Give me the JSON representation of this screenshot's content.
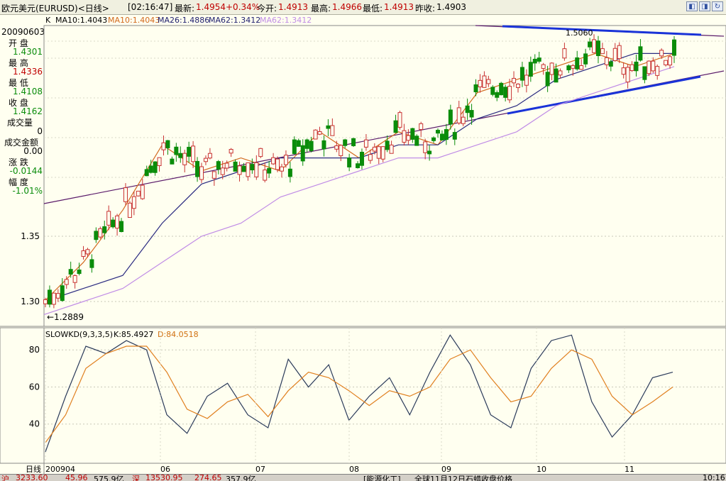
{
  "header": {
    "instrument": "欧元美元(EURUSD)<日线>",
    "time": "[02:16:47]",
    "latest_label": "最新:",
    "latest": "1.4954",
    "change": "+0.34%",
    "open_label": "今开:",
    "open": "1.4913",
    "high_label": "最高:",
    "high": "1.4966",
    "low_label": "最低:",
    "low": "1.4913",
    "prev_label": "昨收:",
    "prev": "1.4903"
  },
  "ma_legend": {
    "prefix": "K",
    "ma10a": "MA10:1.4043",
    "ma10b": "MA10:1.4043",
    "ma26": "MA26:1.4886",
    "ma62": "MA62:1.3412",
    "ma62b": "MA62:1.3412"
  },
  "info_panel": {
    "date": "20090603",
    "open_label": "开  盘",
    "open": "1.4301",
    "high_label": "最  高",
    "high": "1.4336",
    "low_label": "最  低",
    "low": "1.4108",
    "close_label": "收  盘",
    "close": "1.4162",
    "volume_label": "成交量",
    "volume": "0",
    "amount_label": "成交金额",
    "amount": "0.00",
    "change_label": "涨  跌",
    "change": "-0.0144",
    "range_label": "幅  度",
    "range": "-1.01%"
  },
  "price_axis": {
    "ticks": [
      "1.35",
      "1.30"
    ]
  },
  "annotations": {
    "max": "1.5060",
    "min": "←1.2889"
  },
  "kd_legend": {
    "name": "SLOWKD(9,3,3,5)",
    "k": "K:85.4927",
    "d": "D:84.0518"
  },
  "kd_axis": {
    "ticks": [
      "80",
      "60",
      "40"
    ]
  },
  "time_axis": {
    "label": "日线",
    "ticks": [
      "200904",
      "06",
      "07",
      "08",
      "09",
      "10",
      "11"
    ]
  },
  "status_bar": {
    "a": "沪",
    "b": "3233.60",
    "c": "45.96",
    "d": "575.9亿",
    "e": "深",
    "f": "13530.95",
    "g": "274.65",
    "h": "357.9亿",
    "i": "[能源化工]",
    "j": "全球11月12日石蜡收盘价格",
    "k": "10:16"
  },
  "colors": {
    "up": "#c83232",
    "down": "#0a8c0a",
    "ma10": "#d2691e",
    "ma26": "#2a2a80",
    "ma62": "#c08ce6",
    "k_line": "#2a3a5a",
    "d_line": "#e08020",
    "trend": "#1a33d8",
    "trend_thin": "#5a1a6a"
  },
  "chart_data": [
    {
      "type": "candlestick",
      "title": "欧元美元(EURUSD)<日线>",
      "x": [
        "200904",
        "06",
        "07",
        "08",
        "09",
        "10",
        "11"
      ],
      "ylim": [
        1.2889,
        1.506
      ],
      "ticks": [
        1.3,
        1.35
      ],
      "series": [
        {
          "name": "MA10",
          "values": [
            1.3,
            1.33,
            1.37,
            1.42,
            1.4,
            1.41,
            1.4,
            1.43,
            1.41,
            1.43,
            1.42,
            1.46,
            1.47,
            1.48,
            1.49,
            1.48,
            1.49
          ]
        },
        {
          "name": "MA26",
          "values": [
            1.3,
            1.31,
            1.32,
            1.36,
            1.39,
            1.4,
            1.41,
            1.41,
            1.41,
            1.42,
            1.42,
            1.44,
            1.45,
            1.47,
            1.48,
            1.49,
            1.49
          ]
        },
        {
          "name": "MA62",
          "values": [
            1.29,
            1.3,
            1.31,
            1.33,
            1.35,
            1.36,
            1.38,
            1.39,
            1.4,
            1.41,
            1.41,
            1.42,
            1.43,
            1.45,
            1.46,
            1.47,
            1.48
          ]
        }
      ],
      "annotations": [
        "1.5060",
        "←1.2889"
      ]
    },
    {
      "type": "line",
      "title": "SLOWKD(9,3,3,5)",
      "ylim": [
        20,
        95
      ],
      "ticks": [
        40,
        60,
        80
      ],
      "series": [
        {
          "name": "K",
          "values": [
            25,
            55,
            82,
            78,
            85,
            80,
            45,
            35,
            55,
            62,
            45,
            38,
            75,
            60,
            72,
            42,
            55,
            65,
            45,
            68,
            88,
            72,
            45,
            38,
            70,
            85,
            88,
            52,
            33,
            45,
            65,
            68
          ]
        },
        {
          "name": "D",
          "values": [
            30,
            45,
            70,
            78,
            82,
            82,
            68,
            48,
            43,
            52,
            56,
            44,
            58,
            68,
            65,
            58,
            50,
            58,
            55,
            60,
            75,
            80,
            65,
            52,
            55,
            70,
            80,
            75,
            55,
            45,
            52,
            60
          ]
        }
      ]
    }
  ]
}
